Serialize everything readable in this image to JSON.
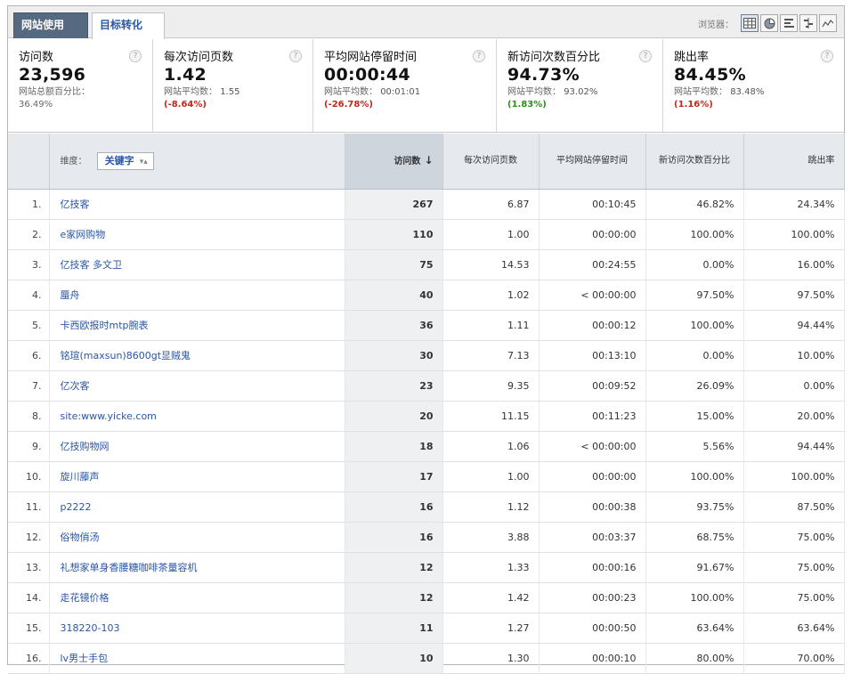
{
  "tabs": [
    {
      "label": "网站使用",
      "active": true
    },
    {
      "label": "目标转化",
      "active": false
    }
  ],
  "viewmode": {
    "label": "浏览器：",
    "icons": [
      "table-icon",
      "pie-icon",
      "bar-icon",
      "comparison-icon",
      "trend-icon"
    ]
  },
  "scorecards": [
    {
      "title": "访问数",
      "value": "23,596",
      "sub_label": "网站总额百分比：",
      "sub_value": "36.49%"
    },
    {
      "title": "每次访问页数",
      "value": "1.42",
      "sub_label": "网站平均数：",
      "avg": "1.55",
      "delta": "(-8.64%)",
      "delta_type": "neg"
    },
    {
      "title": "平均网站停留时间",
      "value": "00:00:44",
      "sub_label": "网站平均数：",
      "avg": "00:01:01",
      "delta": "(-26.78%)",
      "delta_type": "neg"
    },
    {
      "title": "新访问次数百分比",
      "value": "94.73%",
      "sub_label": "网站平均数：",
      "avg": "93.02%",
      "delta": "(1.83%)",
      "delta_type": "pos"
    },
    {
      "title": "跳出率",
      "value": "84.45%",
      "sub_label": "网站平均数：",
      "avg": "83.48%",
      "delta": "(1.16%)",
      "delta_type": "neg"
    }
  ],
  "table": {
    "dimension_label": "维度：",
    "dimension_value": "关键字",
    "headers": [
      "访问数",
      "每次访问页数",
      "平均网站停留时间",
      "新访问次数百分比",
      "跳出率"
    ],
    "rows": [
      {
        "idx": "1.",
        "keyword": "亿技客",
        "visits": "267",
        "pages": "6.87",
        "time": "00:10:45",
        "new": "46.82%",
        "bounce": "24.34%"
      },
      {
        "idx": "2.",
        "keyword": "e家网购物",
        "visits": "110",
        "pages": "1.00",
        "time": "00:00:00",
        "new": "100.00%",
        "bounce": "100.00%"
      },
      {
        "idx": "3.",
        "keyword": "亿技客 多文卫",
        "visits": "75",
        "pages": "14.53",
        "time": "00:24:55",
        "new": "0.00%",
        "bounce": "16.00%"
      },
      {
        "idx": "4.",
        "keyword": "蜃舟",
        "visits": "40",
        "pages": "1.02",
        "time": "< 00:00:00",
        "new": "97.50%",
        "bounce": "97.50%"
      },
      {
        "idx": "5.",
        "keyword": "卡西欧报时mtp腕表",
        "visits": "36",
        "pages": "1.11",
        "time": "00:00:12",
        "new": "100.00%",
        "bounce": "94.44%"
      },
      {
        "idx": "6.",
        "keyword": "铭瑄(maxsun)8600gt显贼鬼",
        "visits": "30",
        "pages": "7.13",
        "time": "00:13:10",
        "new": "0.00%",
        "bounce": "10.00%"
      },
      {
        "idx": "7.",
        "keyword": "亿次客",
        "visits": "23",
        "pages": "9.35",
        "time": "00:09:52",
        "new": "26.09%",
        "bounce": "0.00%"
      },
      {
        "idx": "8.",
        "keyword": "site:www.yicke.com",
        "visits": "20",
        "pages": "11.15",
        "time": "00:11:23",
        "new": "15.00%",
        "bounce": "20.00%"
      },
      {
        "idx": "9.",
        "keyword": "亿技购物网",
        "visits": "18",
        "pages": "1.06",
        "time": "< 00:00:00",
        "new": "5.56%",
        "bounce": "94.44%"
      },
      {
        "idx": "10.",
        "keyword": "旋川藤声",
        "visits": "17",
        "pages": "1.00",
        "time": "00:00:00",
        "new": "100.00%",
        "bounce": "100.00%"
      },
      {
        "idx": "11.",
        "keyword": "p2222",
        "visits": "16",
        "pages": "1.12",
        "time": "00:00:38",
        "new": "93.75%",
        "bounce": "87.50%"
      },
      {
        "idx": "12.",
        "keyword": "俗物俏汤",
        "visits": "16",
        "pages": "3.88",
        "time": "00:03:37",
        "new": "68.75%",
        "bounce": "75.00%"
      },
      {
        "idx": "13.",
        "keyword": "礼想家单身香腰糖咖啡茶量容机",
        "visits": "12",
        "pages": "1.33",
        "time": "00:00:16",
        "new": "91.67%",
        "bounce": "75.00%"
      },
      {
        "idx": "14.",
        "keyword": "走花镜价格",
        "visits": "12",
        "pages": "1.42",
        "time": "00:00:23",
        "new": "100.00%",
        "bounce": "75.00%"
      },
      {
        "idx": "15.",
        "keyword": "318220-103",
        "visits": "11",
        "pages": "1.27",
        "time": "00:00:50",
        "new": "63.64%",
        "bounce": "63.64%"
      },
      {
        "idx": "16.",
        "keyword": "lv男士手包",
        "visits": "10",
        "pages": "1.30",
        "time": "00:00:10",
        "new": "80.00%",
        "bounce": "70.00%"
      }
    ]
  },
  "colors": {
    "link": "#2a56a6",
    "negative": "#c8241b",
    "positive": "#2f8a1f",
    "tab_active_bg": "#556a80"
  }
}
